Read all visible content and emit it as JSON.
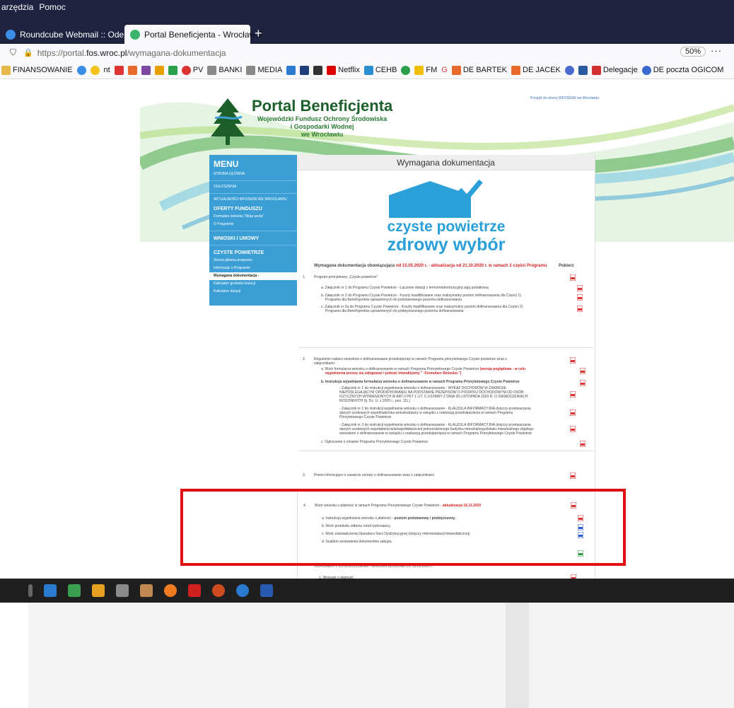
{
  "browser": {
    "menu": [
      "arzędzia",
      "Pomoc"
    ],
    "tabs": [
      {
        "title": "Roundcube Webmail :: Odebra",
        "active": false
      },
      {
        "title": "Portal Beneficjenta - Wrocław",
        "active": true
      }
    ],
    "url": {
      "prefix": "https://portal.",
      "domain": "fos.wroc.pl",
      "path": "/wymagana-dokumentacja"
    },
    "zoom": "50%",
    "more": "···",
    "bookmarks": [
      "FINANSOWANIE",
      "nt",
      "PV",
      "BANKI",
      "MEDIA",
      "Netflix",
      "CEHB",
      "FM",
      "G",
      "DE BARTEK",
      "DE JACEK",
      "Delegacje",
      "DE poczta OGICOM"
    ]
  },
  "site": {
    "logo_title": "Portal Beneficjenta",
    "logo_sub": [
      "Wojewódzki Fundusz Ochrony Środowiska",
      "i Gospodarki Wodnej",
      "we Wrocławiu"
    ],
    "top_note": "Przejdź do strony WFOŚiGW we Wrocławiu"
  },
  "menu": {
    "title": "MENU",
    "items": [
      {
        "label": "STRONA GŁÓWNA",
        "type": "item"
      },
      {
        "label": "OGŁOSZENIA",
        "type": "item"
      },
      {
        "label": "AKTUALNOŚCI WFOŚiGW WE WROCŁAWIU",
        "type": "item"
      },
      {
        "label": "OFERTY FUNDUSZU",
        "type": "section"
      },
      {
        "label": "Formularz wniosku \"Moja woda\"",
        "type": "item"
      },
      {
        "label": "O Programie",
        "type": "item"
      },
      {
        "label": "WNIOSKI I UMOWY",
        "type": "section"
      },
      {
        "label": "CZYSTE POWIETRZE",
        "type": "section"
      },
      {
        "label": "Strona główna programu",
        "type": "item"
      },
      {
        "label": "Informacje o Programie",
        "type": "item"
      },
      {
        "label": "Wymagana dokumentacja -",
        "type": "selected"
      },
      {
        "label": "Kalkulator grubości izolacji",
        "type": "item"
      },
      {
        "label": "Kalkulator dotacji",
        "type": "item"
      }
    ]
  },
  "content": {
    "title": "Wymagana dokumentacja",
    "cp_line1": "czyste powietrze",
    "cp_line2": "zdrowy wybór",
    "intro_a": "Wymagana dokumentacja obowiązująca",
    "intro_b": "od 15.05.2020 r. - aktualizacja od 21.10.2020 r. w ramach 2 części Programu",
    "col_header": "Pobierz",
    "s1": {
      "num": "1.",
      "title": "Program priorytetowy „Czyste powietrze\"",
      "a": "a. Załącznik nr 1 do Programu Czyste Powietrze - Łączenie dotacji z termomodernizacyjną ulgą podatkową",
      "b1": "b. Załącznik nr 2 do Programu Czyste Powietrze - Koszty kwalifikowane oraz maksymalny poziom dofinansowania dla Części 1)",
      "b2": "Programu dla Beneficjentów uprawnionych do podstawowego poziomu dofinansowania",
      "c1": "c. Załącznik nr 2a do Programu Czyste Powietrze - Koszty kwalifikowane oraz maksymalny poziom dofinansowania dla Części 2)",
      "c2": "Programu dla Beneficjentów uprawnionych do podwyższonego poziomu dofinansowania"
    },
    "s2": {
      "num": "2.",
      "t1": "Regulamin naboru wniosków o dofinansowanie przedsięwzięć w ramach Programu priorytetowego Czyste powietrze wraz z",
      "t2": "załącznikami:",
      "a1": "a. Wzór formularza wniosku o dofinansowanie w ramach Programu Priorytetowego Czyste Powietrze",
      "a1r": "(wersja poglądowa - w celu",
      "a2r": "wypełnienia proszę się zalogować i pobrać interaktywny \" -Formularz Wniosku-\")",
      "b": "b. Instrukcja wypełniania formularza wniosku o dofinansowanie w ramach Programu Priorytetowego Czyste Powietrze",
      "z1": [
        "- Załącznik nr 1 do instrukcji wypełniania wniosku o dofinansowanie - WYKAZ DOCHODÓW W ZAKRESIE",
        "NIEPODLEGAJĄCYM OPODATKOWANIU NA PODSTAWIE PRZEPISÓW O PODATKU DOCHODOWYM OD OSÓB",
        "FIZYCZNYCH WYMIENIONYCH W ART.3 PKT 1 LIT. C USTAWY Z DNIA 28 LISTOPADA 2003 R. O ŚWIADCZENIACH",
        "RODZINNYCH (tj. Dz. U. z 2020 r., poz. 111.)"
      ],
      "z2": [
        "- Załącznik nr 2 do instrukcji wypełniania wniosku o dofinansowanie - KLAUZULA INFORMACYJNA dotyczy przetwarzania",
        "danych osobowych współmałżonka wnioskodawcy w związku z realizacją przedsięwzięcia w ramach Programu",
        "Priorytetowego Czyste Powietrze"
      ],
      "z3": [
        "- Załącznik nr 3 do instrukcji wypełniania wniosku o dofinansowanie - KLAUZULA INFORMACYJNA dotyczy przetwarzania",
        "danych osobowych współwłaściciela/współwłaścicieli jednorodzinnego budynku mieszkalnego/lokalu mieszkalnego objętego",
        "wnioskiem o dofinansowanie  w związku z realizacją przedsięwzięcia w ramach Programu Priorytetowego Czyste Powietrze"
      ],
      "c": "c. Ogłoszenie o zmianie Programu Priorytetowego Czyste Powietrze"
    },
    "s3": {
      "num": "3.",
      "title": "Pismo informujące o zawarciu umowy o dofinansowanie wraz z załącznikami"
    },
    "s4": {
      "num": "4.",
      "title": "Wzór wniosku o płatność  w ramach Programu Priorytetowego Czyste Powietrze",
      "update": "- aktualizacja 16.11.2020",
      "a": "a. Instrukcja wypełniania wniosku o płatność",
      "a_bold": "- poziom podstawowy i podwyższony.",
      "b": "b. Wzór protokołu odbioru robót wykonawcy.",
      "c": "c. Wzór zaświadczenia Operatora Sieci Dystrybucyjnej (dotyczy mikroinstalacji fotowoltaicznej)",
      "d": "d. Szablon zestawienia dokumentów zakupu."
    },
    "s5": {
      "heading": "DOKUMENTY DO ROZLICZENIA - WNIOSKI ZŁOŻONE DO 15.05.2020 r.",
      "item": "1.  Wniosek o płatność"
    }
  },
  "colors": {
    "accent_blue": "#3b9fd6",
    "red": "#d32020",
    "chrome_dark": "#202340",
    "highlight": "#e01010"
  }
}
